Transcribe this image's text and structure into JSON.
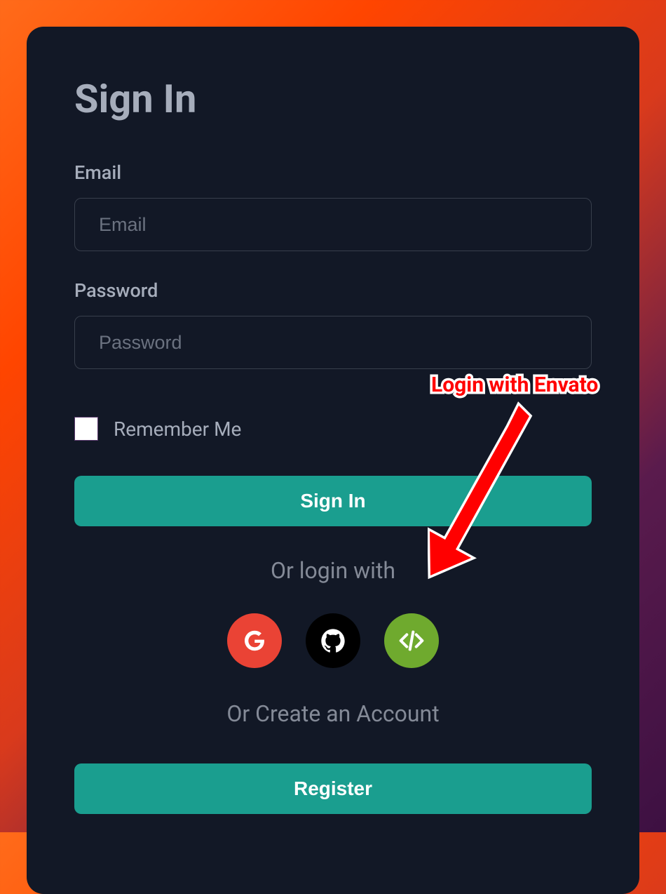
{
  "title": "Sign In",
  "email": {
    "label": "Email",
    "placeholder": "Email"
  },
  "password": {
    "label": "Password",
    "placeholder": "Password"
  },
  "remember_label": "Remember Me",
  "signin_button": "Sign In",
  "or_login_with": "Or login with",
  "or_create": "Or Create an Account",
  "register_button": "Register",
  "social": {
    "google": "google",
    "github": "github",
    "envato": "envato"
  },
  "annotation": {
    "text": "Login with Envato"
  },
  "colors": {
    "primary": "#1a9e8f",
    "card_bg": "#121826",
    "google": "#ea4335",
    "github": "#000000",
    "envato": "#6faa2e"
  }
}
